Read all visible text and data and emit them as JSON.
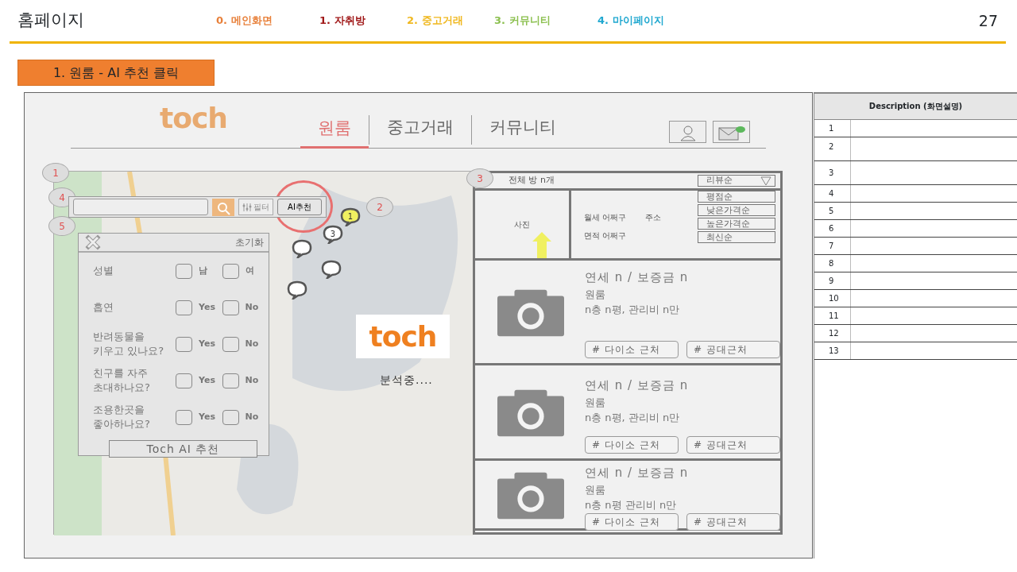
{
  "slide": {
    "title": "홈페이지",
    "page_number": "27"
  },
  "nav": [
    {
      "label": "0. 메인화면",
      "color": "#e8803a"
    },
    {
      "label": "1. 자취방",
      "color": "#a01818"
    },
    {
      "label": "2. 중고거래",
      "color": "#f0b820"
    },
    {
      "label": "3. 커뮤니티",
      "color": "#8cc050"
    },
    {
      "label": "4. 마이페이지",
      "color": "#20a8d0"
    }
  ],
  "section_label": "1. 원룸 - AI 추천 클릭",
  "mockup": {
    "logo": "toch",
    "tabs": [
      {
        "label": "원룸",
        "selected": true
      },
      {
        "label": "중고거래",
        "selected": false
      },
      {
        "label": "커뮤니티",
        "selected": false
      }
    ],
    "map": {
      "callout": "1",
      "search": {
        "callout": "4",
        "filter_button": "필터",
        "ai_button": "AI추천",
        "ai_highlighted": true
      },
      "pins_callout": "2",
      "pins": [
        {
          "label": "1",
          "selected": true
        },
        {
          "label": "3",
          "selected": false
        }
      ],
      "filter_panel": {
        "callout": "5",
        "reset": "초기화",
        "questions": [
          {
            "label": "성별",
            "options": [
              {
                "label": "남",
                "checked": false
              },
              {
                "label": "여",
                "checked": false
              }
            ]
          },
          {
            "label": "흡연",
            "options": [
              {
                "label": "Yes",
                "checked": false
              },
              {
                "label": "No",
                "checked": false
              }
            ]
          },
          {
            "label": "반려동물을 키우고 있나요?",
            "options": [
              {
                "label": "Yes",
                "checked": false
              },
              {
                "label": "No",
                "checked": false
              }
            ]
          },
          {
            "label": "친구를 자주 초대하나요?",
            "options": [
              {
                "label": "Yes",
                "checked": false
              },
              {
                "label": "No",
                "checked": false
              }
            ]
          },
          {
            "label": "조용한곳을 좋아하나요?",
            "options": [
              {
                "label": "Yes",
                "checked": false
              },
              {
                "label": "No",
                "checked": false
              }
            ]
          }
        ],
        "submit": "Toch AI 추천"
      },
      "loading": {
        "logo": "toch",
        "text": "분석중...."
      }
    },
    "list": {
      "callout": "3",
      "count": "전체 방 n개",
      "sort": {
        "label": "리뷰순",
        "expanded": true,
        "options": [
          "평점순",
          "낮은가격순",
          "높은가격순",
          "최신순"
        ]
      },
      "summary": {
        "photo": "사진",
        "rent": "월세 어쩌구",
        "address": "주소",
        "area": "면적 어쩌구"
      },
      "listings": [
        {
          "price": "연세 n / 보증금 n",
          "type": "원룸",
          "detail": "n층 n평, 관리비 n만",
          "tags": [
            "# 다이소 근처",
            "# 공대근처"
          ]
        },
        {
          "price": "연세 n / 보증금 n",
          "type": "원룸",
          "detail": "n층 n평, 관리비 n만",
          "tags": [
            "# 다이소 근처",
            "# 공대근처"
          ]
        },
        {
          "price": "연세 n / 보증금 n",
          "type": "원룸",
          "detail": "n층 n평  관리비 n만",
          "tags": [
            "# 다이소 근처",
            "# 공대근처"
          ]
        }
      ]
    }
  },
  "description": {
    "heading": "Description (화면설명)",
    "rows": [
      "1",
      "2",
      "3",
      "4",
      "5",
      "6",
      "7",
      "8",
      "9",
      "10",
      "11",
      "12",
      "13"
    ]
  }
}
